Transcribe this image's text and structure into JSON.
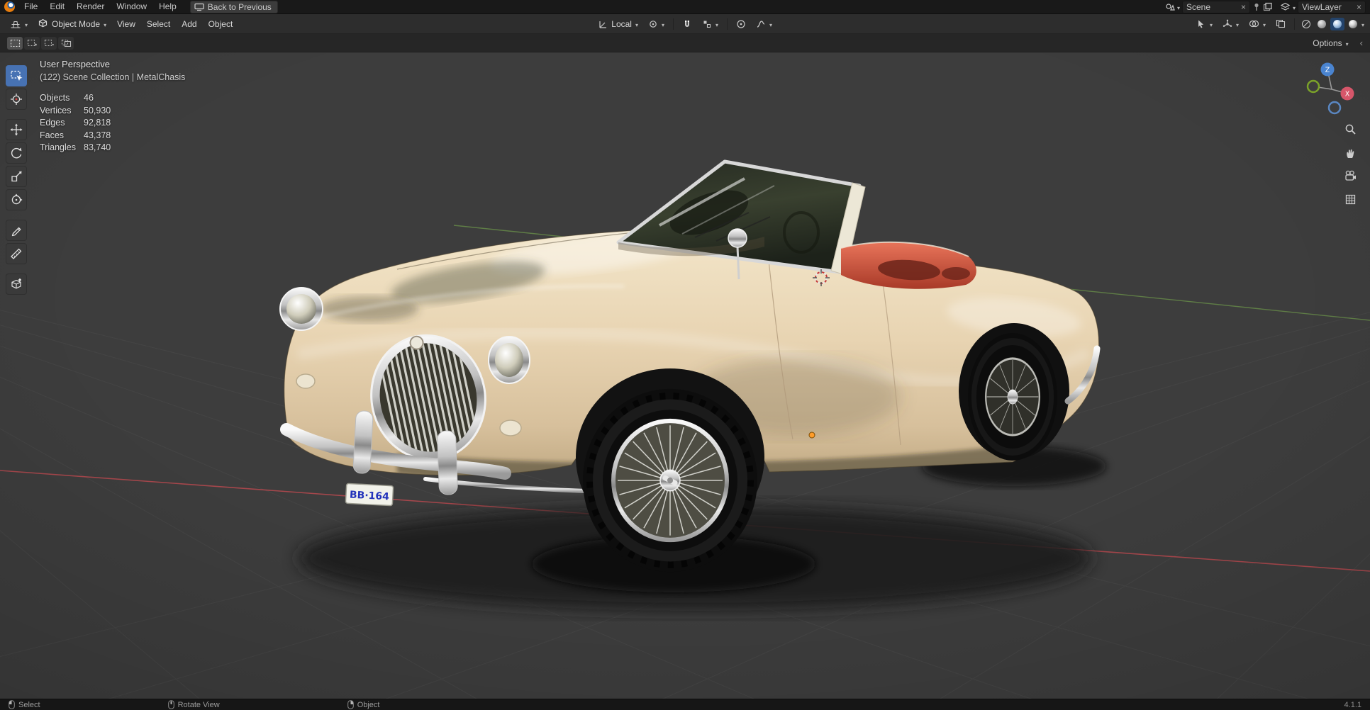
{
  "topbar": {
    "menus": [
      "File",
      "Edit",
      "Render",
      "Window",
      "Help"
    ],
    "back_button": "Back to Previous",
    "scene_label": "Scene",
    "viewlayer_label": "ViewLayer"
  },
  "header": {
    "mode": "Object Mode",
    "menus": [
      "View",
      "Select",
      "Add",
      "Object"
    ],
    "orientation": "Local",
    "options": "Options"
  },
  "viewport": {
    "view_label": "User Perspective",
    "collection_label": "(122) Scene Collection | MetalChasis",
    "stats": [
      {
        "label": "Objects",
        "value": "46"
      },
      {
        "label": "Vertices",
        "value": "50,930"
      },
      {
        "label": "Edges",
        "value": "92,818"
      },
      {
        "label": "Faces",
        "value": "43,378"
      },
      {
        "label": "Triangles",
        "value": "83,740"
      }
    ],
    "gizmo_axes": {
      "z": "Z",
      "x": "X"
    },
    "license_plate": "BB·164"
  },
  "statusbar": {
    "hints": [
      "Select",
      "Rotate View",
      "Object"
    ],
    "version": "4.1.1"
  },
  "colors": {
    "accent_blue": "#4772b3",
    "axis_x_red": "#a6474c",
    "axis_y_green": "#5f7d46",
    "car_body": "#e8d5b6",
    "car_interior": "#cd5540",
    "viewport_bg": "#3d3d3d"
  }
}
